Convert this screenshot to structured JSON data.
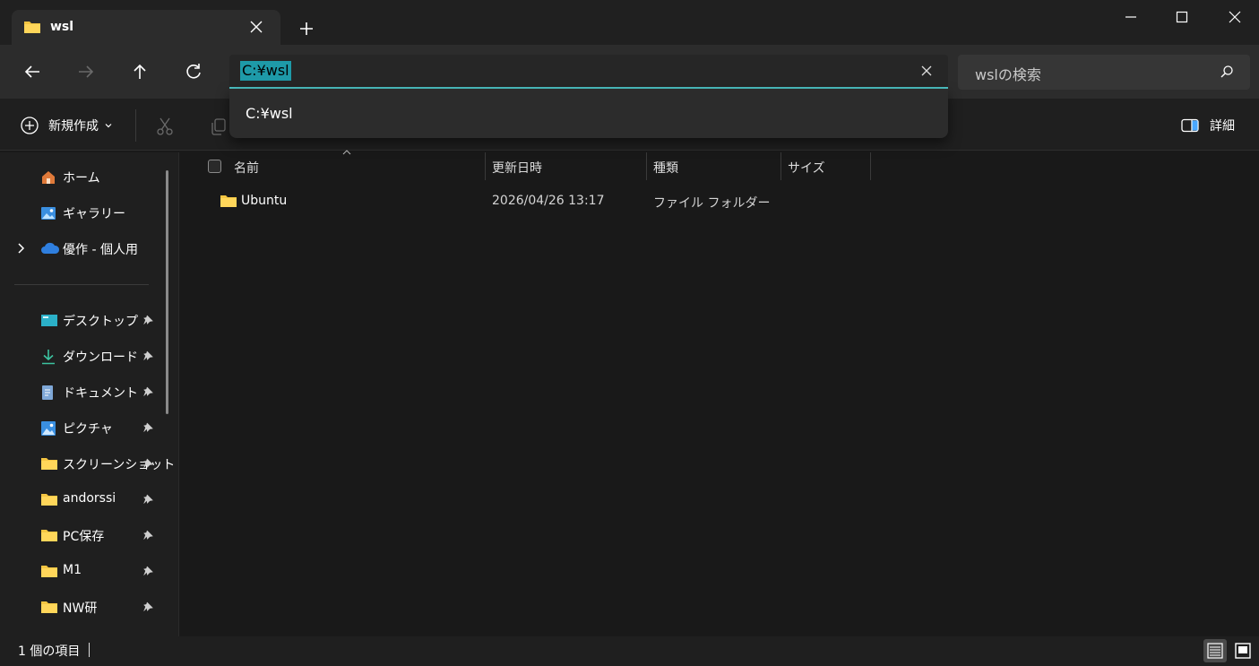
{
  "tab": {
    "title": "wsl"
  },
  "address": {
    "value": "C:¥wsl"
  },
  "search": {
    "placeholder": "wslの検索"
  },
  "dropdown": {
    "items": [
      "C:¥wsl"
    ]
  },
  "toolbar": {
    "new_label": "新規作成",
    "details_label": "詳細"
  },
  "sidebar": {
    "items": [
      {
        "label": "ホーム",
        "icon": "home-icon"
      },
      {
        "label": "ギャラリー",
        "icon": "gallery-icon"
      },
      {
        "label": "優作 - 個人用",
        "icon": "onedrive-icon"
      },
      {
        "label": "デスクトップ",
        "icon": "desktop-icon"
      },
      {
        "label": "ダウンロード",
        "icon": "download-icon"
      },
      {
        "label": "ドキュメント",
        "icon": "document-icon"
      },
      {
        "label": "ピクチャ",
        "icon": "pictures-icon"
      },
      {
        "label": "スクリーンショット",
        "icon": "folder-icon"
      },
      {
        "label": "andorssi",
        "icon": "folder-icon"
      },
      {
        "label": "PC保存",
        "icon": "folder-icon"
      },
      {
        "label": "M1",
        "icon": "folder-icon"
      },
      {
        "label": "NW研",
        "icon": "folder-icon"
      }
    ]
  },
  "columns": {
    "name": "名前",
    "modified": "更新日時",
    "type": "種類",
    "size": "サイズ"
  },
  "files": [
    {
      "name": "Ubuntu",
      "modified": "2026/04/26 13:17",
      "type": "ファイル フォルダー",
      "size": ""
    }
  ],
  "status": {
    "count_text": "1 個の項目"
  },
  "colors": {
    "accent": "#4cc2c4",
    "folder": "#f4c542",
    "background": "#191919"
  }
}
